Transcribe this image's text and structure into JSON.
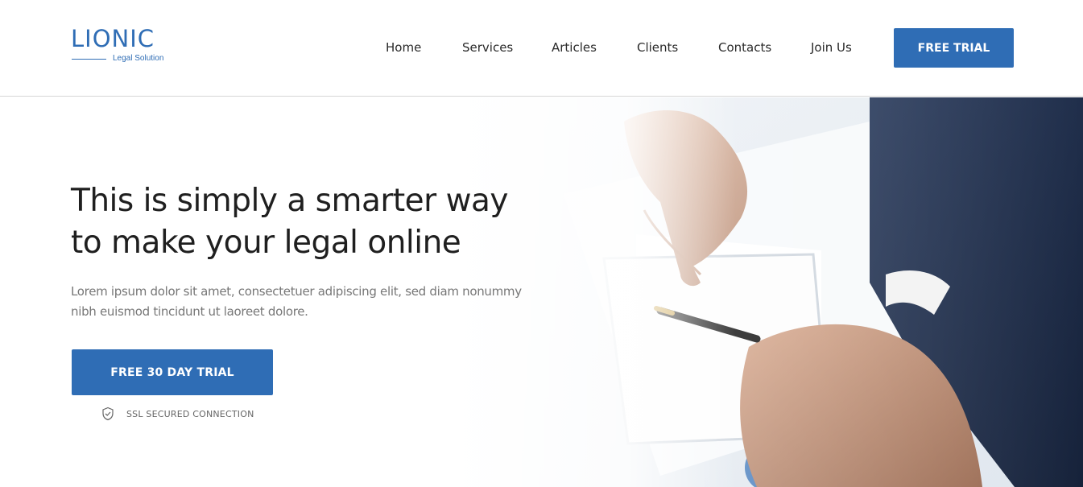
{
  "brand": {
    "name": "LIONIC",
    "tagline": "Legal Solution",
    "accent_color": "#2f6db5"
  },
  "nav": {
    "items": [
      {
        "label": "Home"
      },
      {
        "label": "Services"
      },
      {
        "label": "Articles"
      },
      {
        "label": "Clients"
      },
      {
        "label": "Contacts"
      },
      {
        "label": "Join Us"
      }
    ],
    "cta_label": "FREE TRIAL"
  },
  "hero": {
    "headline_line1": "This is simply a smarter way",
    "headline_line2": "to make your legal online",
    "subtext_line1": "Lorem ipsum dolor sit amet, consectetuer adipiscing elit, sed diam nonummy",
    "subtext_line2": "nibh euismod tincidunt ut laoreet dolore.",
    "cta_label": "FREE 30 DAY TRIAL",
    "ssl_label": "SSL SECURED CONNECTION",
    "ssl_icon": "shield-check-icon",
    "image": "business-people-pointing-at-document"
  }
}
